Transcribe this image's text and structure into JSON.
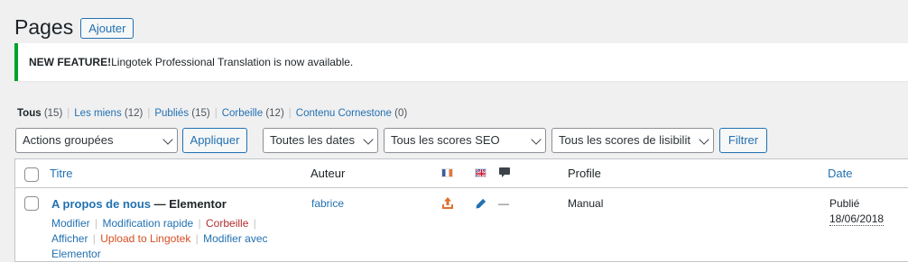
{
  "header": {
    "title": "Pages",
    "add_label": "Ajouter"
  },
  "notice": {
    "strong": "NEW FEATURE!",
    "text": " Lingotek Professional Translation is now available."
  },
  "views": [
    {
      "label": "Tous",
      "count": "(15)"
    },
    {
      "label": "Les miens",
      "count": "(12)"
    },
    {
      "label": "Publiés",
      "count": "(15)"
    },
    {
      "label": "Corbeille",
      "count": "(12)"
    },
    {
      "label": "Contenu Cornestone",
      "count": "(0)"
    }
  ],
  "filters": {
    "bulk_actions": "Actions groupées",
    "apply_label": "Appliquer",
    "dates": "Toutes les dates",
    "seo_scores": "Tous les scores SEO",
    "readability": "Tous les scores de lisibilit",
    "filter_label": "Filtrer"
  },
  "columns": {
    "title": "Titre",
    "author": "Auteur",
    "profile": "Profile",
    "date": "Date"
  },
  "rows": [
    {
      "title": "A propos de nous",
      "state": " — Elementor",
      "author": "fabrice",
      "comments": "—",
      "profile": "Manual",
      "status": "Publié",
      "date": "18/06/2018",
      "actions": {
        "edit": "Modifier",
        "quick_edit": "Modification rapide",
        "trash": "Corbeille",
        "view": "Afficher",
        "upload": "Upload to Lingotek",
        "edit_with": "Modifier avec",
        "elementor": "Elementor"
      }
    }
  ],
  "colors": {
    "accent": "#2271b1",
    "success": "#00a32a",
    "danger": "#b32d2e",
    "lingotek": "#d54e21"
  }
}
